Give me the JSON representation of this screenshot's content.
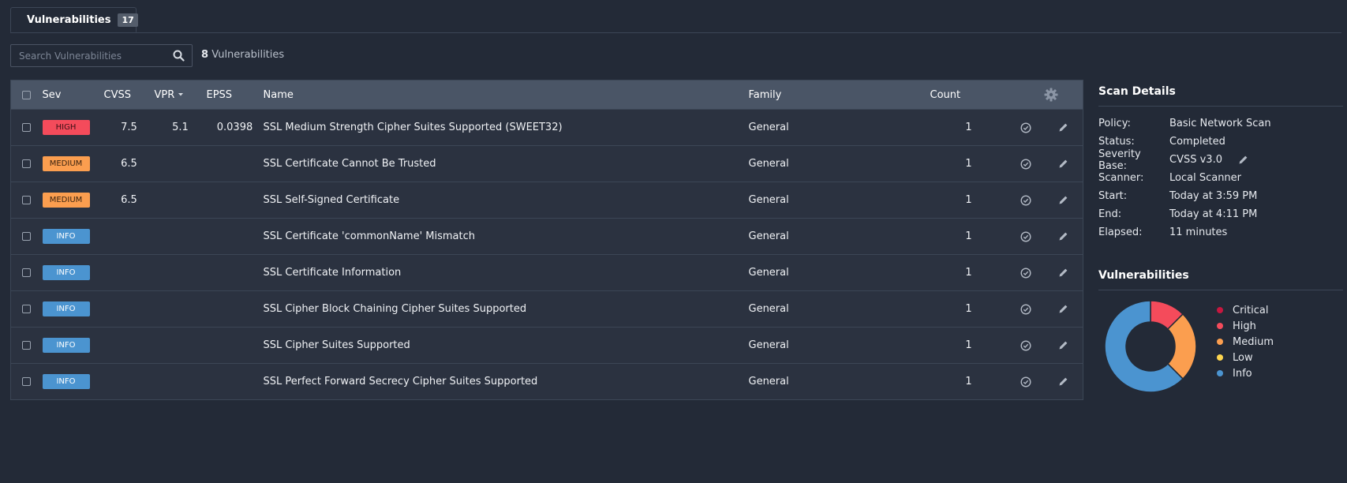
{
  "tab": {
    "label": "Vulnerabilities",
    "badge": "17"
  },
  "search": {
    "placeholder": "Search Vulnerabilities",
    "value": ""
  },
  "summary": {
    "count": "8",
    "suffix": "Vulnerabilities"
  },
  "table": {
    "headers": {
      "sev": "Sev",
      "cvss": "CVSS",
      "vpr": "VPR",
      "epss": "EPSS",
      "name": "Name",
      "family": "Family",
      "count": "Count"
    },
    "rows": [
      {
        "sev": "HIGH",
        "level": "high",
        "cvss": "7.5",
        "vpr": "5.1",
        "epss": "0.0398",
        "name": "SSL Medium Strength Cipher Suites Supported (SWEET32)",
        "family": "General",
        "count": "1"
      },
      {
        "sev": "MEDIUM",
        "level": "medium",
        "cvss": "6.5",
        "vpr": "",
        "epss": "",
        "name": "SSL Certificate Cannot Be Trusted",
        "family": "General",
        "count": "1"
      },
      {
        "sev": "MEDIUM",
        "level": "medium",
        "cvss": "6.5",
        "vpr": "",
        "epss": "",
        "name": "SSL Self-Signed Certificate",
        "family": "General",
        "count": "1"
      },
      {
        "sev": "INFO",
        "level": "info",
        "cvss": "",
        "vpr": "",
        "epss": "",
        "name": "SSL Certificate 'commonName' Mismatch",
        "family": "General",
        "count": "1"
      },
      {
        "sev": "INFO",
        "level": "info",
        "cvss": "",
        "vpr": "",
        "epss": "",
        "name": "SSL Certificate Information",
        "family": "General",
        "count": "1"
      },
      {
        "sev": "INFO",
        "level": "info",
        "cvss": "",
        "vpr": "",
        "epss": "",
        "name": "SSL Cipher Block Chaining Cipher Suites Supported",
        "family": "General",
        "count": "1"
      },
      {
        "sev": "INFO",
        "level": "info",
        "cvss": "",
        "vpr": "",
        "epss": "",
        "name": "SSL Cipher Suites Supported",
        "family": "General",
        "count": "1"
      },
      {
        "sev": "INFO",
        "level": "info",
        "cvss": "",
        "vpr": "",
        "epss": "",
        "name": "SSL Perfect Forward Secrecy Cipher Suites Supported",
        "family": "General",
        "count": "1"
      }
    ]
  },
  "scan_details": {
    "title": "Scan Details",
    "rows": [
      {
        "label": "Policy:",
        "value": "Basic Network Scan"
      },
      {
        "label": "Status:",
        "value": "Completed"
      },
      {
        "label": "Severity Base:",
        "value": "CVSS v3.0",
        "editable": true
      },
      {
        "label": "Scanner:",
        "value": "Local Scanner"
      },
      {
        "label": "Start:",
        "value": "Today at 3:59 PM"
      },
      {
        "label": "End:",
        "value": "Today at 4:11 PM"
      },
      {
        "label": "Elapsed:",
        "value": "11 minutes"
      }
    ]
  },
  "vuln_chart": {
    "title": "Vulnerabilities",
    "legend": [
      {
        "name": "Critical",
        "color": "#c6173f",
        "count": 0
      },
      {
        "name": "High",
        "color": "#f44b5b",
        "count": 1
      },
      {
        "name": "Medium",
        "color": "#fb9e4f",
        "count": 2
      },
      {
        "name": "Low",
        "color": "#fdd54f",
        "count": 0
      },
      {
        "name": "Info",
        "color": "#4b94d0",
        "count": 5
      }
    ]
  },
  "icons": {
    "search": "search-icon",
    "settings": "gear-icon",
    "sort": "caret-down-icon",
    "row_action": "check-circle-icon",
    "edit": "pencil-icon"
  }
}
